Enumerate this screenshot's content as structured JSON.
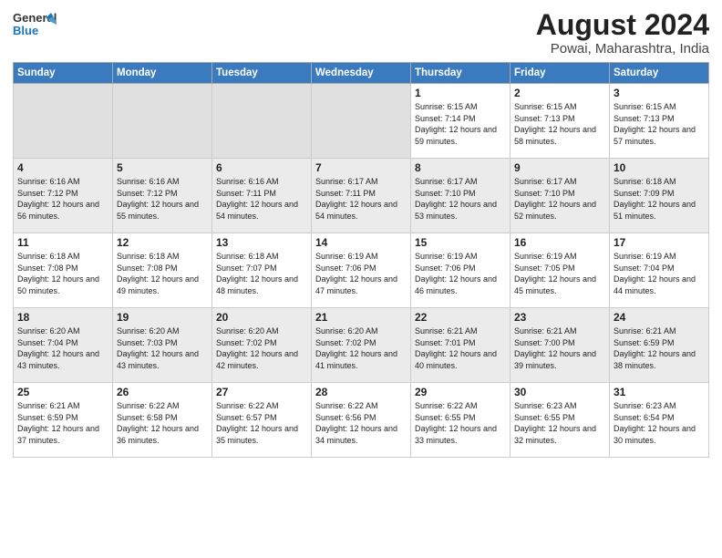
{
  "header": {
    "logo_general": "General",
    "logo_blue": "Blue",
    "month_year": "August 2024",
    "location": "Powai, Maharashtra, India"
  },
  "weekdays": [
    "Sunday",
    "Monday",
    "Tuesday",
    "Wednesday",
    "Thursday",
    "Friday",
    "Saturday"
  ],
  "weeks": [
    [
      {
        "day": "",
        "empty": true
      },
      {
        "day": "",
        "empty": true
      },
      {
        "day": "",
        "empty": true
      },
      {
        "day": "",
        "empty": true
      },
      {
        "day": "1",
        "sunrise": "Sunrise: 6:15 AM",
        "sunset": "Sunset: 7:14 PM",
        "daylight": "Daylight: 12 hours and 59 minutes."
      },
      {
        "day": "2",
        "sunrise": "Sunrise: 6:15 AM",
        "sunset": "Sunset: 7:13 PM",
        "daylight": "Daylight: 12 hours and 58 minutes."
      },
      {
        "day": "3",
        "sunrise": "Sunrise: 6:15 AM",
        "sunset": "Sunset: 7:13 PM",
        "daylight": "Daylight: 12 hours and 57 minutes."
      }
    ],
    [
      {
        "day": "4",
        "sunrise": "Sunrise: 6:16 AM",
        "sunset": "Sunset: 7:12 PM",
        "daylight": "Daylight: 12 hours and 56 minutes."
      },
      {
        "day": "5",
        "sunrise": "Sunrise: 6:16 AM",
        "sunset": "Sunset: 7:12 PM",
        "daylight": "Daylight: 12 hours and 55 minutes."
      },
      {
        "day": "6",
        "sunrise": "Sunrise: 6:16 AM",
        "sunset": "Sunset: 7:11 PM",
        "daylight": "Daylight: 12 hours and 54 minutes."
      },
      {
        "day": "7",
        "sunrise": "Sunrise: 6:17 AM",
        "sunset": "Sunset: 7:11 PM",
        "daylight": "Daylight: 12 hours and 54 minutes."
      },
      {
        "day": "8",
        "sunrise": "Sunrise: 6:17 AM",
        "sunset": "Sunset: 7:10 PM",
        "daylight": "Daylight: 12 hours and 53 minutes."
      },
      {
        "day": "9",
        "sunrise": "Sunrise: 6:17 AM",
        "sunset": "Sunset: 7:10 PM",
        "daylight": "Daylight: 12 hours and 52 minutes."
      },
      {
        "day": "10",
        "sunrise": "Sunrise: 6:18 AM",
        "sunset": "Sunset: 7:09 PM",
        "daylight": "Daylight: 12 hours and 51 minutes."
      }
    ],
    [
      {
        "day": "11",
        "sunrise": "Sunrise: 6:18 AM",
        "sunset": "Sunset: 7:08 PM",
        "daylight": "Daylight: 12 hours and 50 minutes."
      },
      {
        "day": "12",
        "sunrise": "Sunrise: 6:18 AM",
        "sunset": "Sunset: 7:08 PM",
        "daylight": "Daylight: 12 hours and 49 minutes."
      },
      {
        "day": "13",
        "sunrise": "Sunrise: 6:18 AM",
        "sunset": "Sunset: 7:07 PM",
        "daylight": "Daylight: 12 hours and 48 minutes."
      },
      {
        "day": "14",
        "sunrise": "Sunrise: 6:19 AM",
        "sunset": "Sunset: 7:06 PM",
        "daylight": "Daylight: 12 hours and 47 minutes."
      },
      {
        "day": "15",
        "sunrise": "Sunrise: 6:19 AM",
        "sunset": "Sunset: 7:06 PM",
        "daylight": "Daylight: 12 hours and 46 minutes."
      },
      {
        "day": "16",
        "sunrise": "Sunrise: 6:19 AM",
        "sunset": "Sunset: 7:05 PM",
        "daylight": "Daylight: 12 hours and 45 minutes."
      },
      {
        "day": "17",
        "sunrise": "Sunrise: 6:19 AM",
        "sunset": "Sunset: 7:04 PM",
        "daylight": "Daylight: 12 hours and 44 minutes."
      }
    ],
    [
      {
        "day": "18",
        "sunrise": "Sunrise: 6:20 AM",
        "sunset": "Sunset: 7:04 PM",
        "daylight": "Daylight: 12 hours and 43 minutes."
      },
      {
        "day": "19",
        "sunrise": "Sunrise: 6:20 AM",
        "sunset": "Sunset: 7:03 PM",
        "daylight": "Daylight: 12 hours and 43 minutes."
      },
      {
        "day": "20",
        "sunrise": "Sunrise: 6:20 AM",
        "sunset": "Sunset: 7:02 PM",
        "daylight": "Daylight: 12 hours and 42 minutes."
      },
      {
        "day": "21",
        "sunrise": "Sunrise: 6:20 AM",
        "sunset": "Sunset: 7:02 PM",
        "daylight": "Daylight: 12 hours and 41 minutes."
      },
      {
        "day": "22",
        "sunrise": "Sunrise: 6:21 AM",
        "sunset": "Sunset: 7:01 PM",
        "daylight": "Daylight: 12 hours and 40 minutes."
      },
      {
        "day": "23",
        "sunrise": "Sunrise: 6:21 AM",
        "sunset": "Sunset: 7:00 PM",
        "daylight": "Daylight: 12 hours and 39 minutes."
      },
      {
        "day": "24",
        "sunrise": "Sunrise: 6:21 AM",
        "sunset": "Sunset: 6:59 PM",
        "daylight": "Daylight: 12 hours and 38 minutes."
      }
    ],
    [
      {
        "day": "25",
        "sunrise": "Sunrise: 6:21 AM",
        "sunset": "Sunset: 6:59 PM",
        "daylight": "Daylight: 12 hours and 37 minutes."
      },
      {
        "day": "26",
        "sunrise": "Sunrise: 6:22 AM",
        "sunset": "Sunset: 6:58 PM",
        "daylight": "Daylight: 12 hours and 36 minutes."
      },
      {
        "day": "27",
        "sunrise": "Sunrise: 6:22 AM",
        "sunset": "Sunset: 6:57 PM",
        "daylight": "Daylight: 12 hours and 35 minutes."
      },
      {
        "day": "28",
        "sunrise": "Sunrise: 6:22 AM",
        "sunset": "Sunset: 6:56 PM",
        "daylight": "Daylight: 12 hours and 34 minutes."
      },
      {
        "day": "29",
        "sunrise": "Sunrise: 6:22 AM",
        "sunset": "Sunset: 6:55 PM",
        "daylight": "Daylight: 12 hours and 33 minutes."
      },
      {
        "day": "30",
        "sunrise": "Sunrise: 6:23 AM",
        "sunset": "Sunset: 6:55 PM",
        "daylight": "Daylight: 12 hours and 32 minutes."
      },
      {
        "day": "31",
        "sunrise": "Sunrise: 6:23 AM",
        "sunset": "Sunset: 6:54 PM",
        "daylight": "Daylight: 12 hours and 30 minutes."
      }
    ]
  ]
}
